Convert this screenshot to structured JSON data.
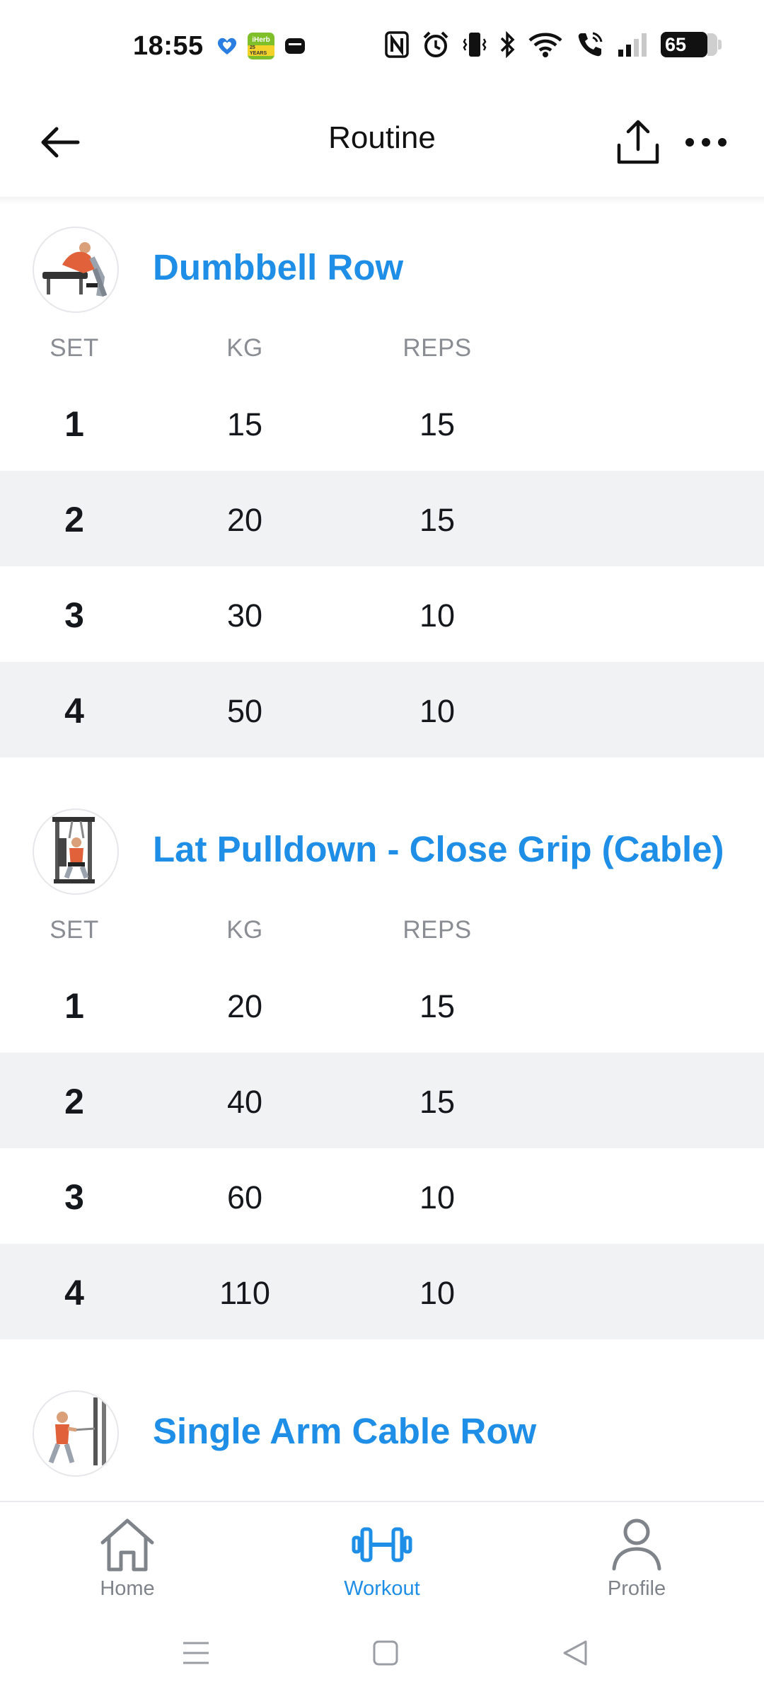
{
  "status_bar": {
    "time": "18:55",
    "battery_level": "65",
    "apps": [
      "health-app-icon",
      "iherb-icon",
      "wallet-icon"
    ],
    "iherb_label": "iHerb",
    "iherb_years": "25 YEARS"
  },
  "header": {
    "title": "Routine"
  },
  "columns": {
    "set": "SET",
    "kg": "KG",
    "reps": "REPS"
  },
  "exercises": [
    {
      "name": "Dumbbell Row",
      "sets": [
        {
          "set": "1",
          "kg": "15",
          "reps": "15"
        },
        {
          "set": "2",
          "kg": "20",
          "reps": "15"
        },
        {
          "set": "3",
          "kg": "30",
          "reps": "10"
        },
        {
          "set": "4",
          "kg": "50",
          "reps": "10"
        }
      ]
    },
    {
      "name": "Lat Pulldown - Close Grip (Cable)",
      "sets": [
        {
          "set": "1",
          "kg": "20",
          "reps": "15"
        },
        {
          "set": "2",
          "kg": "40",
          "reps": "15"
        },
        {
          "set": "3",
          "kg": "60",
          "reps": "10"
        },
        {
          "set": "4",
          "kg": "110",
          "reps": "10"
        }
      ]
    },
    {
      "name": "Single Arm Cable Row",
      "sets": []
    }
  ],
  "bottom_nav": {
    "items": [
      {
        "label": "Home",
        "icon": "home-icon",
        "active": false
      },
      {
        "label": "Workout",
        "icon": "dumbbell-icon",
        "active": true
      },
      {
        "label": "Profile",
        "icon": "profile-icon",
        "active": false
      }
    ]
  },
  "colors": {
    "accent": "#1e8ee6",
    "alt_row": "#f1f2f4",
    "muted_text": "#8a8d93"
  }
}
